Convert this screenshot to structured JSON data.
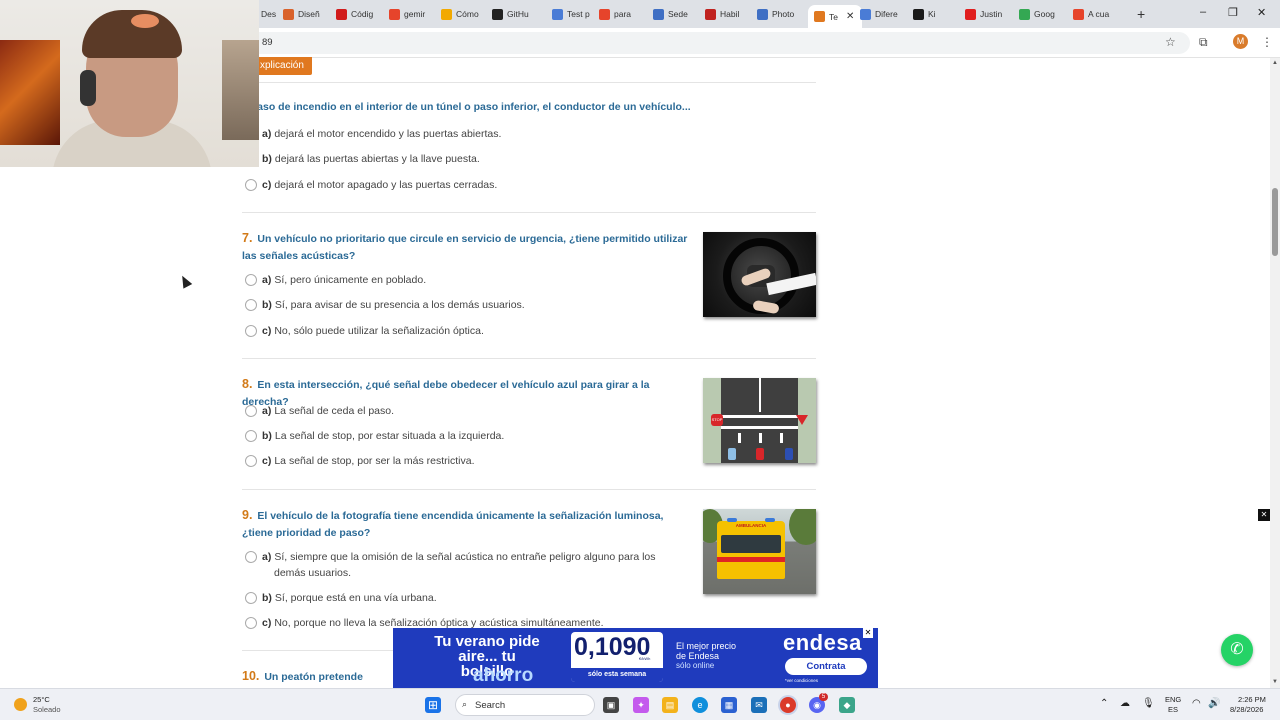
{
  "browser": {
    "tabs": [
      {
        "label": "Desca",
        "icon": "download-icon",
        "color": "#5f6368"
      },
      {
        "label": "Diseñ",
        "icon": "spark-icon",
        "color": "#d9622b"
      },
      {
        "label": "Códig",
        "icon": "opera-icon",
        "color": "#d11b1b"
      },
      {
        "label": "gemir",
        "icon": "brave-icon",
        "color": "#e6442b"
      },
      {
        "label": "Cómo",
        "icon": "edit-icon",
        "color": "#f2a900"
      },
      {
        "label": "GitHu",
        "icon": "github-icon",
        "color": "#222222"
      },
      {
        "label": "Test p",
        "icon": "gemini-icon",
        "color": "#4a7cd6"
      },
      {
        "label": "para",
        "icon": "brave-icon",
        "color": "#e6442b"
      },
      {
        "label": "Sede",
        "icon": "page-icon",
        "color": "#3f6fc4"
      },
      {
        "label": "Habil",
        "icon": "pdf-icon",
        "color": "#c0221f"
      },
      {
        "label": "Photo",
        "icon": "page-icon",
        "color": "#3f6fc4"
      },
      {
        "label": "Te",
        "icon": "test-icon",
        "color": "#e0781f",
        "active": true
      },
      {
        "label": "Difere",
        "icon": "gemini-icon",
        "color": "#4a7cd6"
      },
      {
        "label": "Ki",
        "icon": "kick-icon",
        "color": "#1a1a1a"
      },
      {
        "label": "Justin",
        "icon": "youtube-icon",
        "color": "#e01e1e"
      },
      {
        "label": "Goog",
        "icon": "maps-icon",
        "color": "#34a853"
      },
      {
        "label": "A cua",
        "icon": "brave-icon",
        "color": "#e6442b"
      }
    ],
    "new_tab": "+",
    "window_controls": [
      "–",
      "❐",
      "✕"
    ],
    "url": "89",
    "profile_initial": "M"
  },
  "page": {
    "explicacion_label": "xplicación",
    "questions": [
      {
        "number": "",
        "text": "n caso de incendio en el interior de un túnel o paso inferior, el conductor de un vehículo...",
        "options": [
          {
            "letter": "a)",
            "text": "dejará el motor encendido y las puertas abiertas."
          },
          {
            "letter": "b)",
            "text": "dejará las puertas abiertas y la llave puesta."
          },
          {
            "letter": "c)",
            "text": "dejará el motor apagado y las puertas cerradas."
          }
        ]
      },
      {
        "number": "7.",
        "text": "Un vehículo no prioritario que circule en servicio de urgencia, ¿tiene permitido utilizar las señales acústicas?",
        "options": [
          {
            "letter": "a)",
            "text": "Sí, pero únicamente en poblado."
          },
          {
            "letter": "b)",
            "text": "Sí, para avisar de su presencia a los demás usuarios."
          },
          {
            "letter": "c)",
            "text": "No, sólo puede utilizar la señalización óptica."
          }
        ]
      },
      {
        "number": "8.",
        "text": "En esta intersección, ¿qué señal debe obedecer el vehículo azul para girar a la derecha?",
        "options": [
          {
            "letter": "a)",
            "text": "La señal de ceda el paso."
          },
          {
            "letter": "b)",
            "text": "La señal de stop, por estar situada a la izquierda."
          },
          {
            "letter": "c)",
            "text": "La señal de stop, por ser la más restrictiva."
          }
        ]
      },
      {
        "number": "9.",
        "text": "El vehículo de la fotografía tiene encendida únicamente la señalización luminosa, ¿tiene prioridad de paso?",
        "options": [
          {
            "letter": "a)",
            "text": "Sí, siempre que la omisión de la señal acústica no entrañe peligro alguno para los demás usuarios."
          },
          {
            "letter": "b)",
            "text": "Sí, porque está en una vía urbana."
          },
          {
            "letter": "c)",
            "text": "No, porque no lleva la señalización óptica y acústica simultáneamente."
          }
        ]
      },
      {
        "number": "10.",
        "text": "Un peatón pretende cruzar",
        "options": []
      }
    ],
    "images": {
      "stop_sign_text": "STOP",
      "ambulance_text": "AMBULANCIA"
    }
  },
  "ad": {
    "headline": "Tu verano pide aire... tu bolsillo",
    "headline_emphasis": "ahorro",
    "price": "0,1090",
    "price_unit": "€/kWh",
    "price_note": "sólo esta semana",
    "tagline": "El mejor precio de Endesa",
    "tagline_sub": "sólo online",
    "brand": "endesa",
    "button": "Contrata",
    "legal": "*ver condiciones",
    "close": "✕"
  },
  "overlays": {
    "side_close": "✕",
    "whatsapp_icon": "✆"
  },
  "taskbar": {
    "weather_temp": "25°C",
    "weather_desc": "Soleado",
    "search_placeholder": "Search",
    "lang_top": "ENG",
    "lang_bottom": "ES",
    "time": "2:26 PM",
    "date": "8/28/2026",
    "app_badge": "5"
  }
}
